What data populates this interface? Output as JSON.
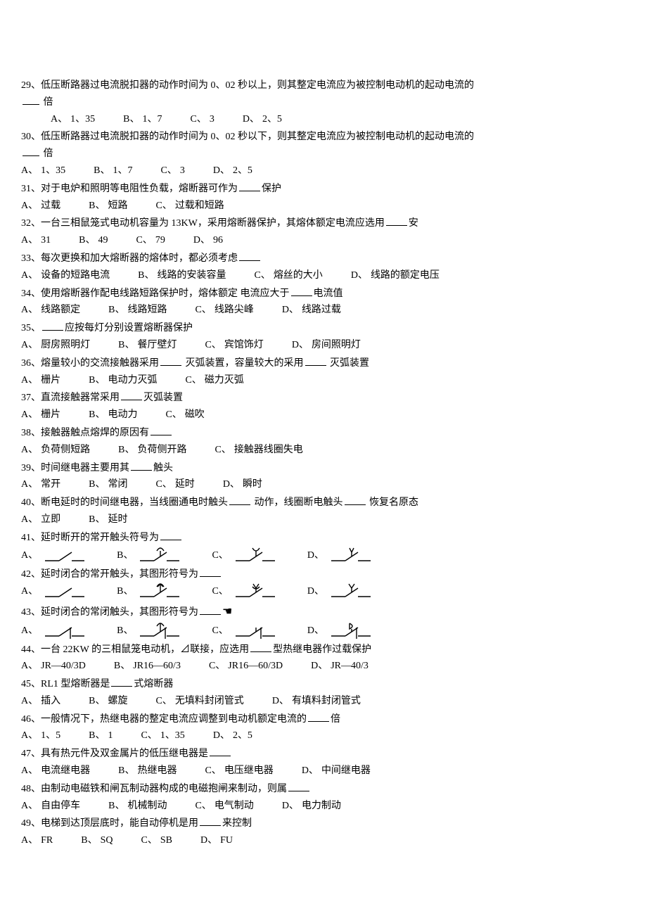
{
  "questions": [
    {
      "id": "q29",
      "stem": "29、低压断路器过电流脱扣器的动作时间为 0、02 秒以上，则其整定电流应为被控制电动机的起动电流的",
      "stem_tail": "倍",
      "indent_opts": true,
      "opts": [
        {
          "l": "A、",
          "v": "1、35"
        },
        {
          "l": "B、",
          "v": " 1、7"
        },
        {
          "l": "C、",
          "v": "3"
        },
        {
          "l": "D、",
          "v": "2、5"
        }
      ]
    },
    {
      "id": "q30",
      "stem": "30、低压断路器过电流脱扣器的动作时间为 0、02 秒以下，则其整定电流应为被控制电动机的起动电流的",
      "stem_tail": "倍",
      "opts": [
        {
          "l": "A、",
          "v": "1、35"
        },
        {
          "l": "B、",
          "v": "1、7"
        },
        {
          "l": "C、",
          "v": "3"
        },
        {
          "l": "D、",
          "v": "2、5"
        }
      ]
    },
    {
      "id": "q31",
      "stem_pre": "31、对于电炉和照明等电阻性负载，熔断器可作为",
      "stem_post": "保护",
      "opts": [
        {
          "l": "A、",
          "v": "过载"
        },
        {
          "l": "B、",
          "v": " 短路"
        },
        {
          "l": "C、",
          "v": "过载和短路"
        }
      ]
    },
    {
      "id": "q32",
      "stem_pre": "32、一台三相鼠笼式电动机容量为 13KW，采用熔断器保护，其熔体额定电流应选用",
      "stem_post": "安",
      "opts": [
        {
          "l": "A、",
          "v": "31"
        },
        {
          "l": "B、",
          "v": "49"
        },
        {
          "l": "C、",
          "v": "79"
        },
        {
          "l": "D、",
          "v": "96"
        }
      ]
    },
    {
      "id": "q33",
      "stem_pre": "33、每次更换和加大熔断器的熔体时，都必须考虑",
      "opts": [
        {
          "l": "A、",
          "v": "设备的短路电流"
        },
        {
          "l": "B、",
          "v": " 线路的安装容量"
        },
        {
          "l": "C、",
          "v": " 熔丝的大小"
        },
        {
          "l": "D、",
          "v": " 线路的额定电压"
        }
      ]
    },
    {
      "id": "q34",
      "stem_pre": "34、使用熔断器作配电线路短路保护时，熔体额定 电流应大于",
      "stem_post": "电流值",
      "opts": [
        {
          "l": "A、",
          "v": "线路额定"
        },
        {
          "l": "B、",
          "v": " 线路短路"
        },
        {
          "l": "C、",
          "v": "线路尖峰"
        },
        {
          "l": "D、",
          "v": " 线路过载"
        }
      ]
    },
    {
      "id": "q35",
      "stem_pre": "35、",
      "stem_post": "应按每灯分别设置熔断器保护",
      "opts": [
        {
          "l": "A、",
          "v": "厨房照明灯"
        },
        {
          "l": "B、",
          "v": "餐厅壁灯"
        },
        {
          "l": "C、",
          "v": " 宾馆饰灯"
        },
        {
          "l": "D、",
          "v": "房间照明灯"
        }
      ]
    },
    {
      "id": "q36",
      "stem_pre": "36、熔量较小的交流接触器采用",
      "stem_mid": "灭弧装置，容量较大的采用",
      "stem_post": "灭弧装置",
      "opts": [
        {
          "l": "A、",
          "v": "栅片"
        },
        {
          "l": "B、",
          "v": " 电动力灭弧"
        },
        {
          "l": "C、",
          "v": "磁力灭弧"
        }
      ]
    },
    {
      "id": "q37",
      "stem_pre": "37、直流接触器常采用",
      "stem_post": "灭弧装置",
      "opts": [
        {
          "l": "A、",
          "v": "栅片"
        },
        {
          "l": "B、",
          "v": "电动力"
        },
        {
          "l": "C、",
          "v": " 磁吹"
        }
      ]
    },
    {
      "id": "q38",
      "stem_pre": "38、接触器触点熔焊的原因有",
      "opts": [
        {
          "l": "A、",
          "v": "负荷侧短路"
        },
        {
          "l": "B、",
          "v": " 负荷侧开路"
        },
        {
          "l": "C、",
          "v": " 接触器线圈失电"
        }
      ]
    },
    {
      "id": "q39",
      "stem_pre": "39、时间继电器主要用其",
      "stem_post": "触头",
      "opts": [
        {
          "l": "A、",
          "v": "常开"
        },
        {
          "l": "B、",
          "v": " 常闭"
        },
        {
          "l": "C、",
          "v": " 延时"
        },
        {
          "l": "D、",
          "v": " 瞬时"
        }
      ]
    },
    {
      "id": "q40",
      "stem_pre": "40、断电延时的时间继电器，当线圈通电时触头",
      "stem_mid": "动作，线圈断电触头",
      "stem_post": "恢复名原态",
      "opts": [
        {
          "l": "A、",
          "v": "立即"
        },
        {
          "l": "B、",
          "v": " 延时"
        }
      ]
    },
    {
      "id": "q41",
      "stem_pre": "41、延时断开的常开触头符号为",
      "symbol_opts": true,
      "opts": [
        {
          "l": "A、",
          "v": "",
          "sym": "switch"
        },
        {
          "l": "B、",
          "v": "",
          "sym": "switch-cup-down"
        },
        {
          "l": "C、",
          "v": "",
          "sym": "switch-cup-up"
        },
        {
          "l": "D、",
          "v": "",
          "sym": "switch-cup-y"
        }
      ]
    },
    {
      "id": "q42",
      "stem_pre": "42、延时闭合的常开触头，其图形符号为",
      "symbol_opts": true,
      "opts": [
        {
          "l": "A、",
          "v": "",
          "sym": "switch"
        },
        {
          "l": "B、",
          "v": "",
          "sym": "switch-arrow-up"
        },
        {
          "l": "C、",
          "v": "",
          "sym": "switch-cup-y2"
        },
        {
          "l": "D、",
          "v": "",
          "sym": "switch-cup-y3"
        }
      ]
    },
    {
      "id": "q43",
      "stem_pre": "43、延时闭合的常闭触头，其图形符号为",
      "sym_right": "hand",
      "symbol_opts": true,
      "opts": [
        {
          "l": "A、",
          "v": "",
          "sym": "closed"
        },
        {
          "l": "B、",
          "v": "",
          "sym": "closed-arrow-up"
        },
        {
          "l": "C、",
          "v": "",
          "sym": "closed-box"
        },
        {
          "l": "D、",
          "v": "",
          "sym": "closed-d"
        }
      ]
    },
    {
      "id": "q44",
      "stem_pre": "44、一台 22KW 的三相鼠笼电动机，⊿联接，应选用",
      "stem_post": "型热继电器作过载保护",
      "opts": [
        {
          "l": "A、",
          "v": "JR—40/3D"
        },
        {
          "l": "B、",
          "v": "JR16—60/3"
        },
        {
          "l": "C、",
          "v": "JR16—60/3D"
        },
        {
          "l": "D、",
          "v": "JR—40/3"
        }
      ]
    },
    {
      "id": "q45",
      "stem_pre": "45、RL1 型熔断器是",
      "stem_post": "式熔断器",
      "opts": [
        {
          "l": "A、",
          "v": "插入"
        },
        {
          "l": "B、",
          "v": "螺旋"
        },
        {
          "l": "C、",
          "v": "无填料封闭管式"
        },
        {
          "l": "D、",
          "v": " 有填料封闭管式"
        }
      ]
    },
    {
      "id": "q46",
      "stem_pre": "46、一般情况下，热继电器的整定电流应调整到电动机额定电流的",
      "stem_post": "倍",
      "opts": [
        {
          "l": "A、",
          "v": "1、5"
        },
        {
          "l": "B、",
          "v": "1"
        },
        {
          "l": "C、",
          "v": "1、35"
        },
        {
          "l": "D、",
          "v": "2、5"
        }
      ]
    },
    {
      "id": "q47",
      "stem_pre": "47、具有热元件及双金属片的低压继电器是",
      "opts": [
        {
          "l": "A、",
          "v": "电流继电器"
        },
        {
          "l": "B、",
          "v": " 热继电器"
        },
        {
          "l": "C、",
          "v": " 电压继电器"
        },
        {
          "l": "D、",
          "v": " 中间继电器"
        }
      ]
    },
    {
      "id": "q48",
      "stem_pre": "48、由制动电磁铁和闸瓦制动器构成的电磁抱闸来制动，则属",
      "opts": [
        {
          "l": "A、",
          "v": "自由停车"
        },
        {
          "l": "B、",
          "v": " 机械制动"
        },
        {
          "l": "C、",
          "v": " 电气制动"
        },
        {
          "l": "D、",
          "v": " 电力制动"
        }
      ]
    },
    {
      "id": "q49",
      "stem_pre": "49、电梯到达顶层底时，能自动停机是用",
      "stem_post": "来控制",
      "opts": [
        {
          "l": "A、",
          "v": "FR"
        },
        {
          "l": "B、",
          "v": "SQ"
        },
        {
          "l": "C、",
          "v": "SB"
        },
        {
          "l": "D、",
          "v": "FU"
        }
      ]
    }
  ]
}
